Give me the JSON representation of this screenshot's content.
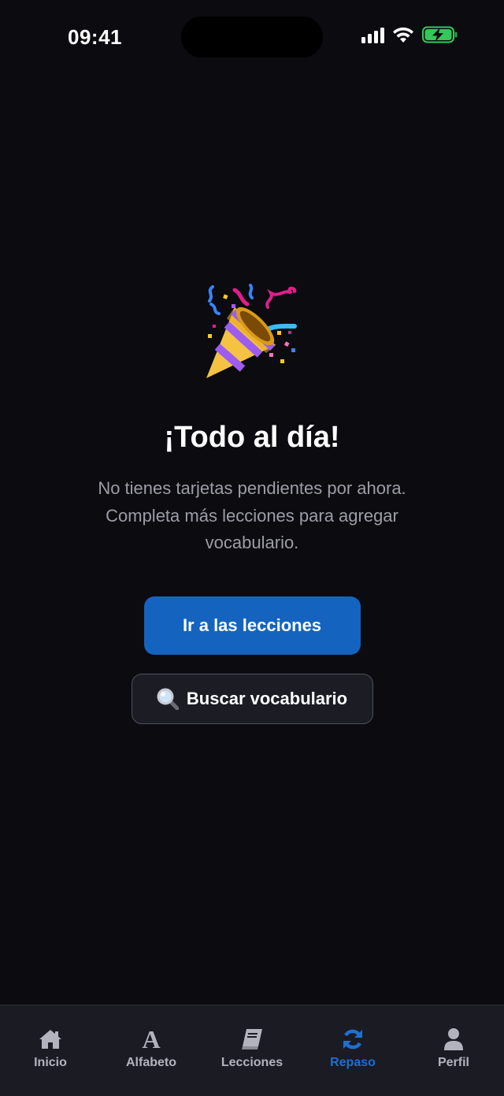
{
  "status_bar": {
    "time": "09:41",
    "icons": [
      "signal-icon",
      "wifi-icon",
      "battery-charging-icon"
    ]
  },
  "empty_state": {
    "icon": "party-popper-icon",
    "title": "¡Todo al día!",
    "subtitle": "No tienes tarjetas pendientes por ahora. Completa más lecciones para agregar vocabulario.",
    "primary_button": "Ir a las lecciones",
    "secondary_button": "Buscar vocabulario",
    "secondary_icon": "magnifier-icon"
  },
  "tab_bar": {
    "active_tab": "Repaso",
    "tabs": [
      {
        "label": "Inicio",
        "icon": "home-icon"
      },
      {
        "label": "Alfabeto",
        "icon": "alphabet-icon"
      },
      {
        "label": "Lecciones",
        "icon": "book-icon"
      },
      {
        "label": "Repaso",
        "icon": "refresh-icon"
      },
      {
        "label": "Perfil",
        "icon": "user-icon"
      }
    ]
  },
  "colors": {
    "background": "#0b0b10",
    "primary": "#1464bf",
    "active_tab": "#1f6fd1",
    "inactive_tab": "#b3b3be",
    "subtitle": "#9d9da8",
    "battery": "#34c759"
  }
}
